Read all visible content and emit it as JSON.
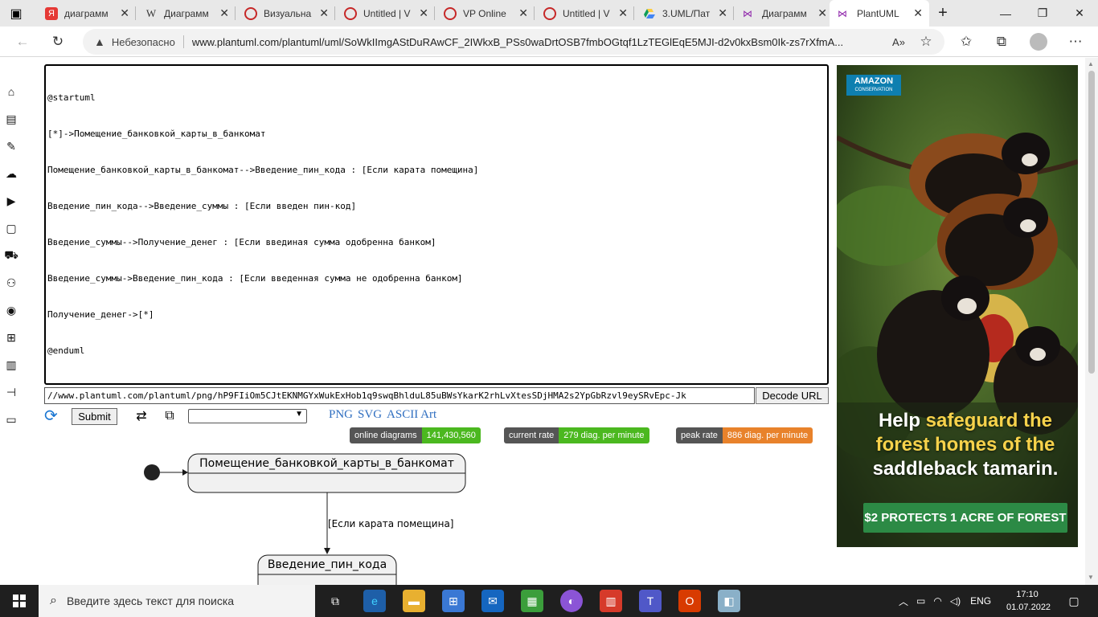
{
  "browser": {
    "tabs": [
      {
        "title": "диаграмм",
        "favicon_color": "#e53935",
        "favicon_glyph": "Я"
      },
      {
        "title": "Диаграмм",
        "favicon_color": "#ffffff",
        "favicon_glyph": "W"
      },
      {
        "title": "Визуальна",
        "favicon_color": "#c62828",
        "favicon_glyph": "◉"
      },
      {
        "title": "Untitled | V",
        "favicon_color": "#c62828",
        "favicon_glyph": "◉"
      },
      {
        "title": "VP Online",
        "favicon_color": "#c62828",
        "favicon_glyph": "◉"
      },
      {
        "title": "Untitled | V",
        "favicon_color": "#c62828",
        "favicon_glyph": "◉"
      },
      {
        "title": "3.UML/Пат",
        "favicon_color": "#1e88e5",
        "favicon_glyph": "▲"
      },
      {
        "title": "Диаграмм",
        "favicon_color": "#8e24aa",
        "favicon_glyph": "⋈"
      },
      {
        "title": "PlantUML",
        "favicon_color": "#8e24aa",
        "favicon_glyph": "⋈"
      }
    ],
    "insecure_label": "Небезопасно",
    "url": "www.plantuml.com/plantuml/uml/SoWkIImgAStDuRAwCF_2IWkxB_PSs0waDrtOSB7fmbOGtqf1LzTEGlEqE5MJI-d2v0kxBsm0Ik-zs7rXfmA..."
  },
  "editor": {
    "lines": [
      "@startuml",
      "[*]->Помещение_банковкой_карты_в_банкомат",
      "Помещение_банковкой_карты_в_банкомат-->Введение_пин_кода : [Если карата помещина]",
      "Введение_пин_кода-->Введение_суммы : [Если введен пин-код]",
      "Введение_суммы-->Получение_денег : [Если введиная сумма одобренна банком]",
      "Введение_суммы->Введение_пин_кода : [Если введенная сумма не одобренна банком]",
      "Получение_денег->[*]",
      "@enduml"
    ]
  },
  "url_field": "//www.plantuml.com/plantuml/png/hP9FIiOm5CJtEKNMGYxWukExHob1q9swqBhlduL85uBWsYkarK2rhLvXtesSDjHMA2s2YpGbRzvl9eySRvEpc-Jk",
  "buttons": {
    "decode": "Decode URL",
    "submit": "Submit"
  },
  "format_links": [
    "PNG",
    "SVG",
    "ASCII Art"
  ],
  "stats": [
    {
      "label": "online diagrams",
      "value": "141,430,560",
      "color": "#4bb81f"
    },
    {
      "label": "current rate",
      "value": "279 diag. per minute",
      "color": "#4bb81f"
    },
    {
      "label": "peak rate",
      "value": "886 diag. per minute",
      "color": "#e8822b"
    }
  ],
  "diagram": {
    "state1": "Помещение_банковкой_карты_в_банкомат",
    "transition1": "[Если карата помещина]",
    "state2": "Введение_пин_кода"
  },
  "ad": {
    "logo_main": "AMAZON",
    "logo_sub": "CONSERVATION",
    "headline_1": "Help ",
    "headline_hl_1": "safeguard the",
    "headline_hl_2": "forest homes of the",
    "headline_3": "saddleback tamarin.",
    "cta": "$2 PROTECTS 1 ACRE OF FOREST"
  },
  "taskbar": {
    "search_placeholder": "Введите здесь текст для поиска",
    "language": "ENG",
    "time": "17:10",
    "date": "01.07.2022"
  }
}
